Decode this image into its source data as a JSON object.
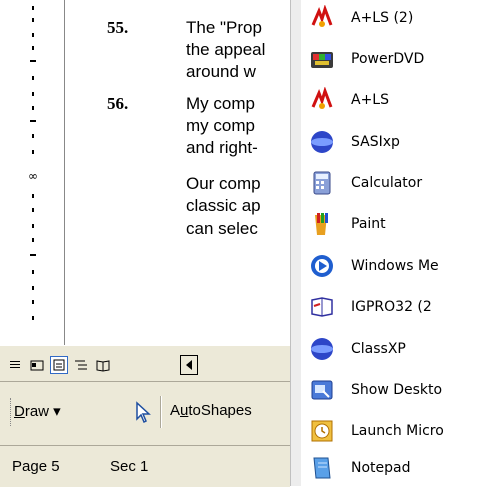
{
  "document": {
    "ruler_marker": "∞",
    "lines": [
      {
        "num": "55.",
        "text": "The \"Prop"
      },
      {
        "num": "",
        "text": "the appeal"
      },
      {
        "num": "",
        "text": "around w"
      },
      {
        "num": "56.",
        "text": "My comp"
      },
      {
        "num": "",
        "text": "my comp"
      },
      {
        "num": "",
        "text": "and right-"
      },
      {
        "num": "",
        "text": "Our comp"
      },
      {
        "num": "",
        "text": "classic ap"
      },
      {
        "num": "",
        "text": "can selec"
      }
    ]
  },
  "view_bar": {
    "buttons": [
      "normal-view",
      "web-layout-view",
      "print-layout-view",
      "outline-view",
      "reading-view"
    ]
  },
  "drawing_toolbar": {
    "draw_label_underlined": "D",
    "draw_label_rest": "raw ▾",
    "autoshapes_pre": "A",
    "autoshapes_underlined": "u",
    "autoshapes_rest": "toShapes"
  },
  "status_bar": {
    "page": "Page 5",
    "section": "Sec 1"
  },
  "menu": {
    "items": [
      {
        "label": "A+LS (2)",
        "icon": "als-icon"
      },
      {
        "label": "PowerDVD",
        "icon": "powerdvd-icon"
      },
      {
        "label": "A+LS",
        "icon": "als-icon"
      },
      {
        "label": "SASIxp",
        "icon": "sasixp-icon"
      },
      {
        "label": "Calculator",
        "icon": "calculator-icon"
      },
      {
        "label": "Paint",
        "icon": "paint-icon"
      },
      {
        "label": "Windows Me",
        "icon": "windows-media-icon"
      },
      {
        "label": "IGPRO32 (2",
        "icon": "igpro-icon"
      },
      {
        "label": "ClassXP",
        "icon": "classxp-icon"
      },
      {
        "label": "Show Deskto",
        "icon": "show-desktop-icon"
      },
      {
        "label": "Launch Micro",
        "icon": "launch-icon"
      },
      {
        "label": "Notepad",
        "icon": "notepad-icon"
      }
    ]
  }
}
